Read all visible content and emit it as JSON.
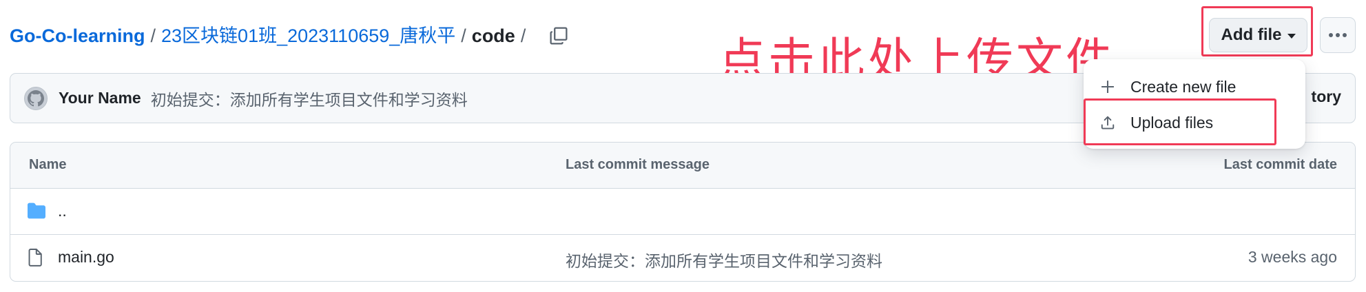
{
  "breadcrumb": {
    "repo": "Go-Co-learning",
    "separator": "/",
    "folder": "23区块链01班_2023110659_唐秋平",
    "current": "code",
    "trailing_sep": "/"
  },
  "toolbar": {
    "add_file_label": "Add file"
  },
  "annotation": {
    "text": "点击此处上传文件",
    "color": "#f03a56"
  },
  "commit": {
    "author": "Your Name",
    "message": "初始提交：添加所有学生项目文件和学习资料",
    "history_label": "tory"
  },
  "table": {
    "headers": {
      "name": "Name",
      "message": "Last commit message",
      "date": "Last commit date"
    },
    "rows": [
      {
        "type": "folder",
        "name": "..",
        "message": "",
        "date": ""
      },
      {
        "type": "file",
        "name": "main.go",
        "message": "初始提交：添加所有学生项目文件和学习资料",
        "date": "3 weeks ago"
      }
    ]
  },
  "dropdown": {
    "items": [
      {
        "icon": "plus-icon",
        "label": "Create new file"
      },
      {
        "icon": "upload-icon",
        "label": "Upload files"
      }
    ]
  },
  "colors": {
    "link": "#0969da",
    "folder": "#54aeff",
    "highlight": "#f03a56"
  }
}
